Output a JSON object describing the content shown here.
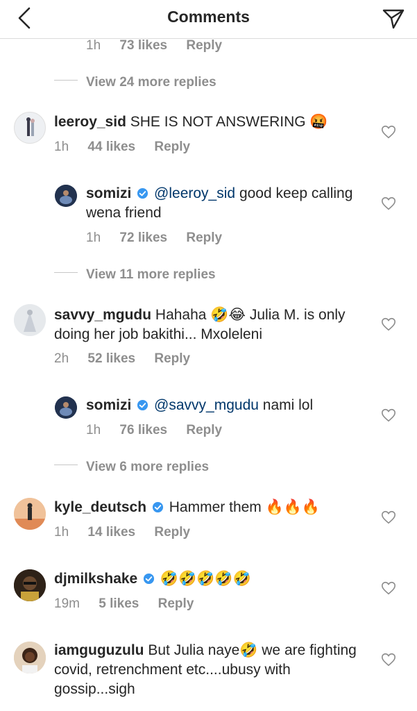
{
  "header": {
    "title": "Comments"
  },
  "labels": {
    "reply": "Reply"
  },
  "top_meta": {
    "time": "1h",
    "likes": "73 likes"
  },
  "view_more": [
    "View 24 more replies",
    "View 11 more replies",
    "View 6 more replies"
  ],
  "comments": [
    {
      "user": "leeroy_sid",
      "text": "SHE IS NOT ANSWERING",
      "emoji": "🤬",
      "time": "1h",
      "likes": "44 likes"
    },
    {
      "user": "somizi",
      "mention": "@leeroy_sid",
      "text": "good keep calling wena friend",
      "time": "1h",
      "likes": "72 likes"
    },
    {
      "user": "savvy_mgudu",
      "text_before": "Hahaha",
      "emoji": "🤣😂",
      "text_after": "Julia M. is only doing her job bakithi... Mxoleleni",
      "time": "2h",
      "likes": "52 likes"
    },
    {
      "user": "somizi",
      "mention": "@savvy_mgudu",
      "text": "nami lol",
      "time": "1h",
      "likes": "76 likes"
    },
    {
      "user": "kyle_deutsch",
      "text": "Hammer them",
      "emoji": "🔥🔥🔥",
      "time": "1h",
      "likes": "14 likes"
    },
    {
      "user": "djmilkshake",
      "emoji": "🤣🤣🤣🤣🤣",
      "time": "19m",
      "likes": "5 likes"
    },
    {
      "user": "iamguguzulu",
      "text_before": "But Julia naye",
      "emoji": "🤣",
      "text_after": "we are fighting covid, retrenchment etc....ubusy with gossip...sigh"
    }
  ],
  "colors": {
    "meta": "#8e8e8e",
    "mention": "#00376b",
    "verified": "#3897f0",
    "divider": "#dbdbdb"
  }
}
